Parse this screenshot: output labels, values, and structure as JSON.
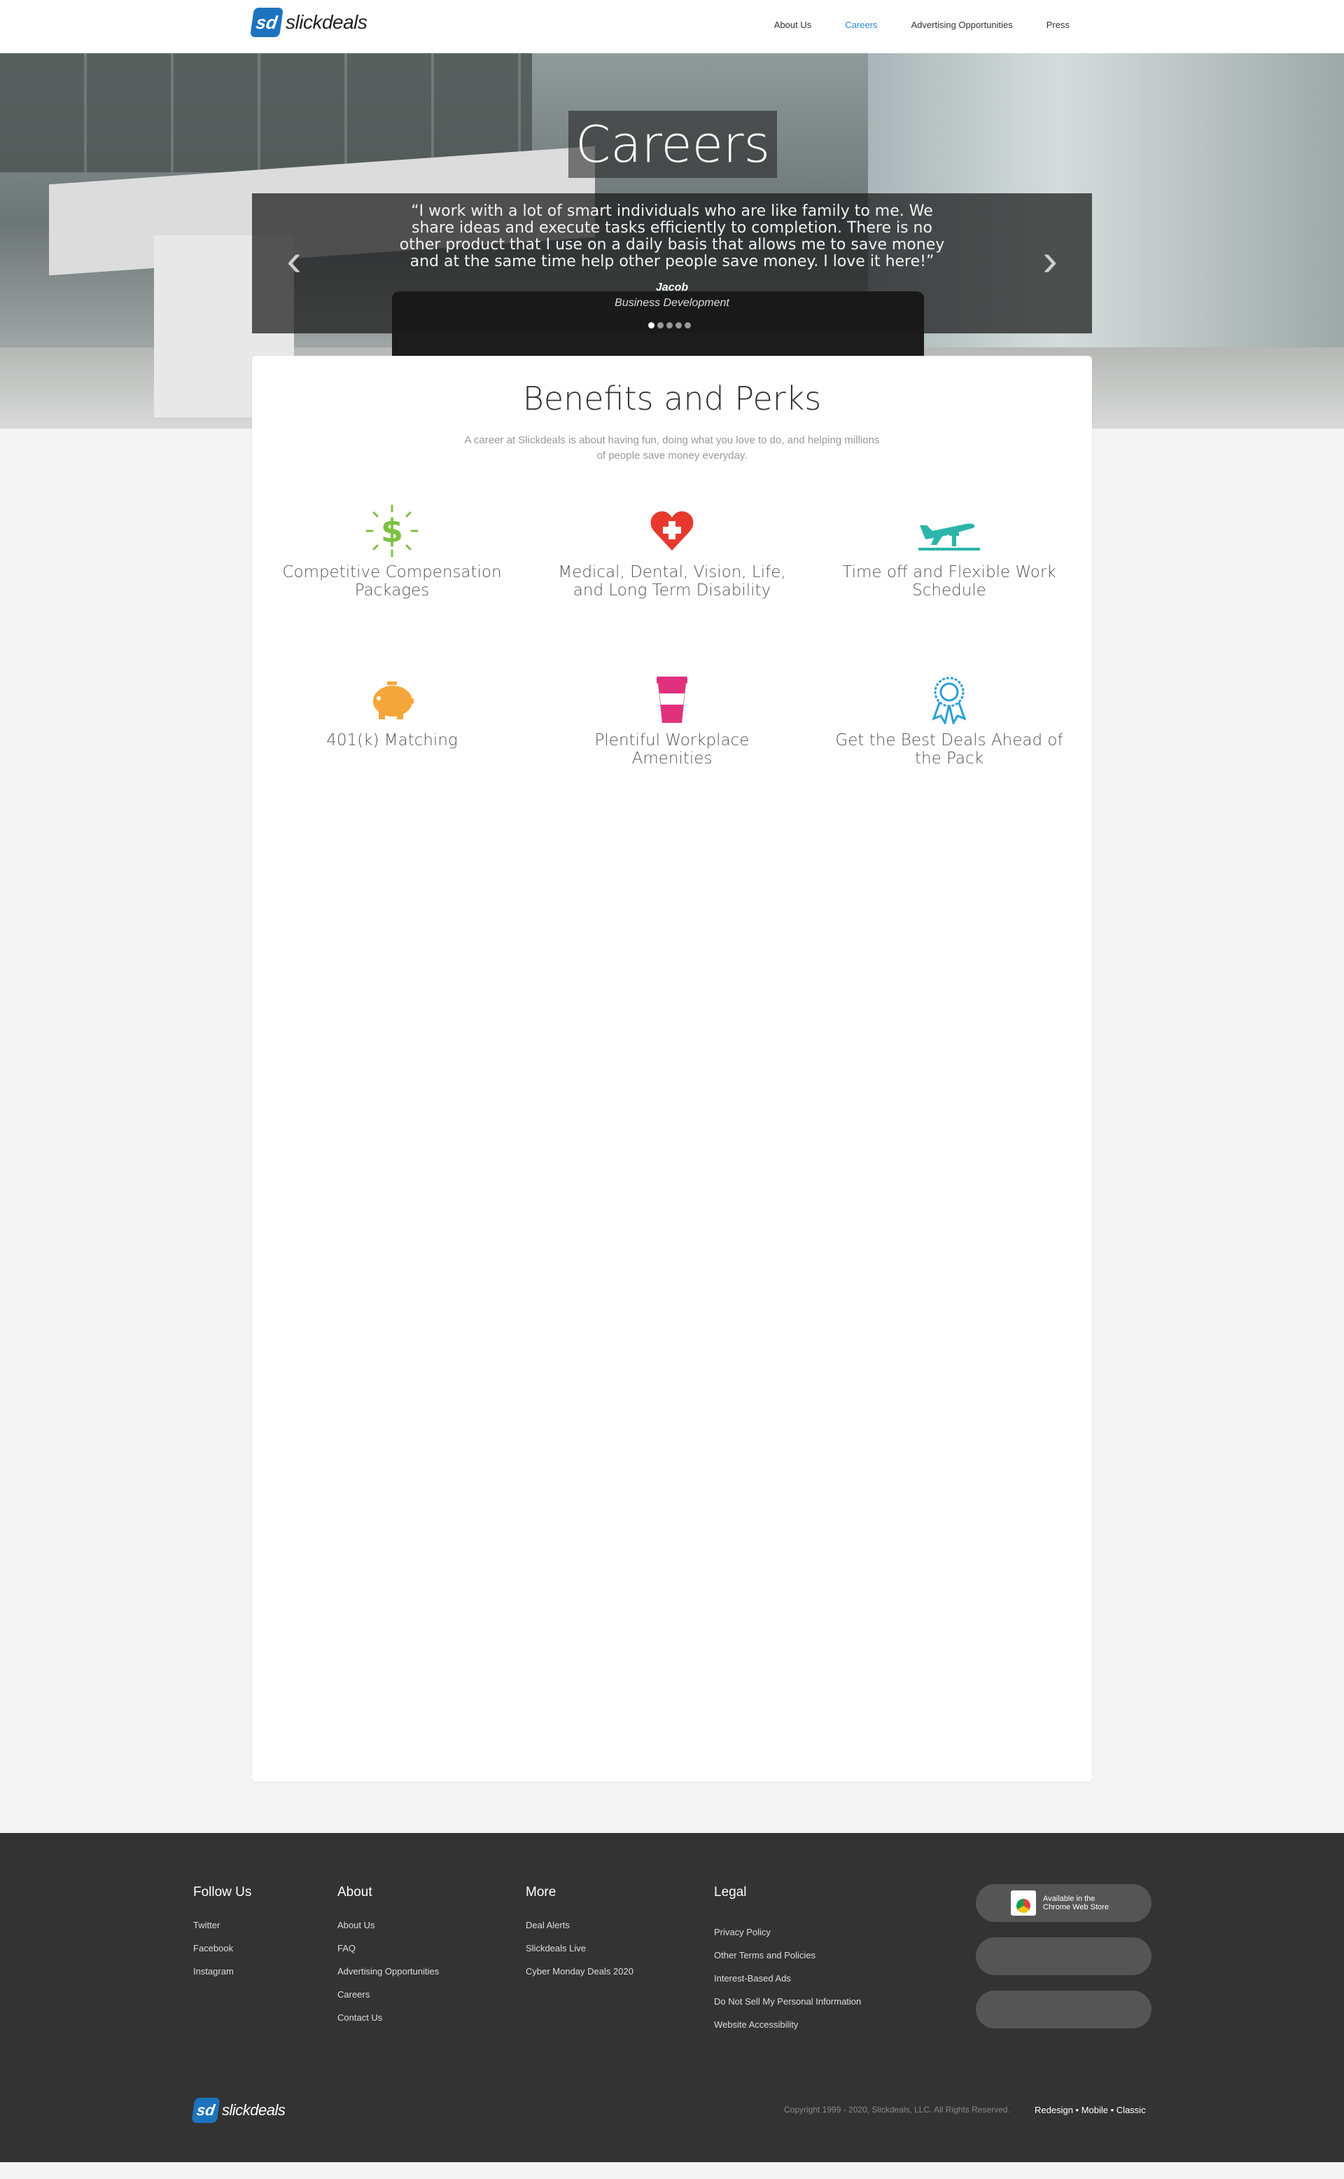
{
  "header": {
    "logo_text": "slickdeals",
    "logo_mark": "sd",
    "nav": [
      {
        "label": "About Us",
        "active": false
      },
      {
        "label": "Careers",
        "active": true
      },
      {
        "label": "Advertising Opportunities",
        "active": false
      },
      {
        "label": "Press",
        "active": false
      }
    ]
  },
  "hero": {
    "title": "Careers",
    "quote": "“I work with a lot of smart individuals who are like family to me. We share ideas and execute tasks efficiently to completion. There is no other product that I use on a daily basis that allows me to save money and at the same time help other people save money. I love it here!”",
    "name": "Jacob",
    "role": "Business Development",
    "prev_icon": "chevron-left-icon",
    "next_icon": "chevron-right-icon",
    "slides_total": 5,
    "active_slide": 1
  },
  "benefits": {
    "title": "Benefits and Perks",
    "subtitle": "A career at Slickdeals is about having fun, doing what you love to do, and helping millions of people save money everyday.",
    "items": [
      {
        "label": "Competitive Compensation Packages",
        "icon": "dollar-icon",
        "color": "#7dc142"
      },
      {
        "label": "Medical, Dental, Vision, Life, and Long Term Disability",
        "icon": "heart-cross-icon",
        "color": "#e8382d"
      },
      {
        "label": "Time off and Flexible Work Schedule",
        "icon": "airplane-icon",
        "color": "#2bb5a8"
      },
      {
        "label": "401(k) Matching",
        "icon": "piggy-bank-icon",
        "color": "#f5a63b"
      },
      {
        "label": "Plentiful Workplace Amenities",
        "icon": "coffee-cup-icon",
        "color": "#e0327c"
      },
      {
        "label": "Get the Best Deals Ahead of the Pack",
        "icon": "award-ribbon-icon",
        "color": "#2a9fd6"
      }
    ]
  },
  "footer": {
    "columns": [
      {
        "title": "Follow Us",
        "links": [
          "Twitter",
          "Facebook",
          "Instagram"
        ]
      },
      {
        "title": "About",
        "links": [
          "About Us",
          "FAQ",
          "Advertising Opportunities",
          "Careers",
          "Contact Us"
        ]
      },
      {
        "title": "More",
        "links": [
          "Deal Alerts",
          "Slickdeals Live",
          "Cyber Monday Deals 2020"
        ]
      },
      {
        "title": "Legal",
        "links": [
          "Privacy Policy",
          "Other Terms and Policies",
          "Interest-Based Ads",
          "Do Not Sell My Personal Information",
          "Website Accessibility"
        ]
      }
    ],
    "chrome_badge": {
      "line1": "Available in the",
      "line2": "Chrome Web Store"
    },
    "logo_text": "slickdeals",
    "copyright": "Copyright 1999 - 2020, Slickdeals, LLC. All Rights Reserved.",
    "versions": [
      "Redesign",
      "Mobile",
      "Classic"
    ]
  }
}
